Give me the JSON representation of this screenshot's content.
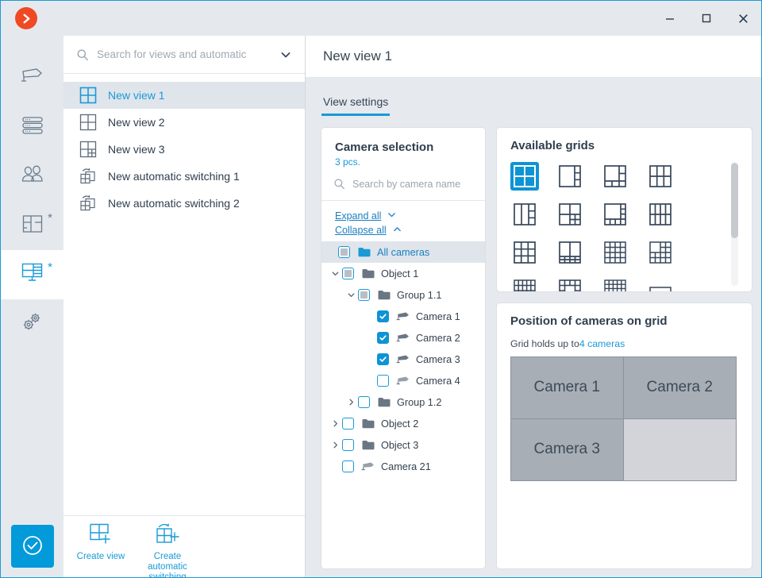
{
  "window": {
    "logo_icon": "orange-chevron-logo",
    "minimize_label": "–",
    "maximize_label": "□",
    "close_label": "✕"
  },
  "rail": {
    "items": [
      {
        "id": "cameras",
        "icon": "camera-icon",
        "active": false,
        "star": ""
      },
      {
        "id": "servers",
        "icon": "server-rack-icon",
        "active": false,
        "star": ""
      },
      {
        "id": "users",
        "icon": "users-icon",
        "active": false,
        "star": ""
      },
      {
        "id": "plans",
        "icon": "floorplan-icon",
        "active": false,
        "star": "*"
      },
      {
        "id": "views",
        "icon": "monitor-views-icon",
        "active": true,
        "star": "*"
      },
      {
        "id": "settings",
        "icon": "gears-icon",
        "active": false,
        "star": ""
      }
    ],
    "apply_icon": "check-circle-icon"
  },
  "views_panel": {
    "search": {
      "placeholder": "Search for views and automatic",
      "value": "",
      "icon": "search-icon",
      "dropdown_icon": "chevron-down-icon"
    },
    "items": [
      {
        "label": "New view 1",
        "icon": "grid-2x2-icon",
        "selected": true
      },
      {
        "label": "New view 2",
        "icon": "grid-2x2-icon",
        "selected": false
      },
      {
        "label": "New view 3",
        "icon": "grid-2x2-split-icon",
        "selected": false
      },
      {
        "label": "New automatic switching 1",
        "icon": "auto-switching-icon",
        "selected": false
      },
      {
        "label": "New automatic switching 2",
        "icon": "auto-switching-icon",
        "selected": false
      }
    ],
    "footer": {
      "create_view_label": "Create view",
      "create_view_icon": "add-view-icon",
      "create_switching_label": "Create automatic switching",
      "create_switching_icon": "add-auto-switching-icon"
    }
  },
  "main": {
    "title": "New view 1",
    "tabs": [
      {
        "label": "View settings",
        "active": true
      }
    ]
  },
  "camera_selection": {
    "title": "Camera selection",
    "count_label": "3 pcs.",
    "search": {
      "placeholder": "Search by camera name",
      "value": "",
      "icon": "search-icon"
    },
    "expand_all_label": "Expand all",
    "expand_all_icon": "chevron-down-icon",
    "collapse_all_label": "Collapse all",
    "collapse_all_icon": "chevron-up-icon",
    "tree": [
      {
        "label": "All cameras",
        "icon": "folder-icon",
        "indent": 0,
        "arrow": "none",
        "check": "partial",
        "highlighted": true
      },
      {
        "label": "Object 1",
        "icon": "folder-icon",
        "indent": 1,
        "arrow": "down",
        "check": "partial",
        "highlighted": false
      },
      {
        "label": "Group 1.1",
        "icon": "folder-icon",
        "indent": 2,
        "arrow": "down",
        "check": "partial",
        "highlighted": false
      },
      {
        "label": "Camera 1",
        "icon": "camera-icon",
        "indent": 3,
        "arrow": "none",
        "check": "checked",
        "highlighted": false
      },
      {
        "label": "Camera 2",
        "icon": "camera-icon",
        "indent": 3,
        "arrow": "none",
        "check": "checked",
        "highlighted": false
      },
      {
        "label": "Camera 3",
        "icon": "camera-icon",
        "indent": 3,
        "arrow": "none",
        "check": "checked",
        "highlighted": false
      },
      {
        "label": "Camera 4",
        "icon": "camera-icon",
        "indent": 3,
        "arrow": "none",
        "check": "unchecked",
        "highlighted": false
      },
      {
        "label": "Group 1.2",
        "icon": "folder-icon",
        "indent": 2,
        "arrow": "right",
        "check": "unchecked",
        "highlighted": false
      },
      {
        "label": "Object 2",
        "icon": "folder-icon",
        "indent": 1,
        "arrow": "right",
        "check": "unchecked",
        "highlighted": false
      },
      {
        "label": "Object 3",
        "icon": "folder-icon",
        "indent": 1,
        "arrow": "right",
        "check": "unchecked",
        "highlighted": false
      },
      {
        "label": "Camera 21",
        "icon": "camera-icon",
        "indent": 1,
        "arrow": "none",
        "check": "unchecked",
        "highlighted": false
      }
    ]
  },
  "available_grids": {
    "title": "Available grids",
    "selected_index": 0,
    "items": [
      {
        "name": "grid-2x2",
        "pattern": "2x2"
      },
      {
        "name": "grid-1-plus-3-right",
        "pattern": "1+3r"
      },
      {
        "name": "grid-big-left-plus-side-bottom",
        "pattern": "big-l-shape"
      },
      {
        "name": "grid-2x3",
        "pattern": "3x2"
      },
      {
        "name": "grid-2cols-plus-3-right",
        "pattern": "2c+3r"
      },
      {
        "name": "grid-2x2-quad-bottom-right",
        "pattern": "2x2-br4"
      },
      {
        "name": "grid-big-plus-right-and-bottom",
        "pattern": "big-rb"
      },
      {
        "name": "grid-4x2",
        "pattern": "4x2"
      },
      {
        "name": "grid-3x3",
        "pattern": "3x3"
      },
      {
        "name": "grid-2x2-bottom-strip",
        "pattern": "2x2-bs"
      },
      {
        "name": "grid-4x4",
        "pattern": "4x4"
      },
      {
        "name": "grid-4x4-big-topleft",
        "pattern": "4x4-tl"
      },
      {
        "name": "grid-5x4",
        "pattern": "5x4"
      },
      {
        "name": "grid-ring",
        "pattern": "ring"
      },
      {
        "name": "grid-5x5",
        "pattern": "5x5"
      }
    ],
    "scrollbar_icon": "vertical-scrollbar"
  },
  "position_on_grid": {
    "title": "Position of cameras on grid",
    "capacity_prefix": "Grid holds up to",
    "capacity_value": "4 cameras",
    "cells": [
      {
        "label": "Camera 1",
        "empty": false
      },
      {
        "label": "Camera 2",
        "empty": false
      },
      {
        "label": "Camera 3",
        "empty": false
      },
      {
        "label": "",
        "empty": true
      }
    ]
  },
  "colors": {
    "accent": "#1a9ad7",
    "accent_dark": "#0d94d5",
    "brand_orange": "#ef4a24",
    "panel_bg": "#e6eaee",
    "text_dark": "#2f3e4e"
  }
}
